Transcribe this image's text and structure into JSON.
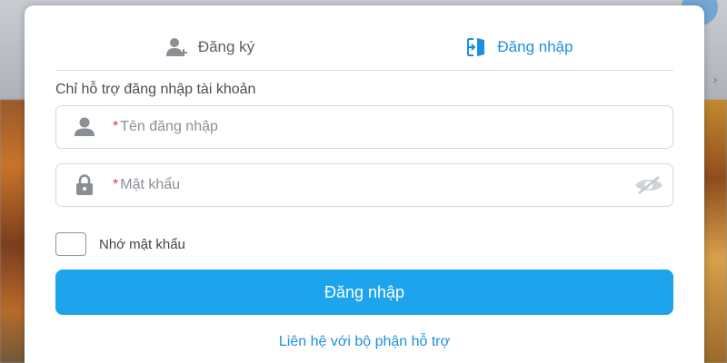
{
  "colors": {
    "accent": "#1D8FE0",
    "button": "#1EA4EC",
    "required": "#E23B3B"
  },
  "tabs": [
    {
      "label": "Đăng ký",
      "icon": "add-user-icon",
      "active": false
    },
    {
      "label": "Đăng nhập",
      "icon": "login-door-icon",
      "active": true
    }
  ],
  "hint": "Chỉ hỗ trợ đăng nhập tài khoản",
  "username": {
    "required_mark": "*",
    "placeholder": "Tên đăng nhập",
    "value": "",
    "icon": "user-icon"
  },
  "password": {
    "required_mark": "*",
    "placeholder": "Mật khẩu",
    "value": "",
    "icon": "lock-icon",
    "toggle_icon": "eye-slash-icon"
  },
  "remember": {
    "label": "Nhớ mật khẩu",
    "checked": false
  },
  "submit_label": "Đăng nhập",
  "support_link": "Liên hệ với bộ phận hỗ trợ"
}
